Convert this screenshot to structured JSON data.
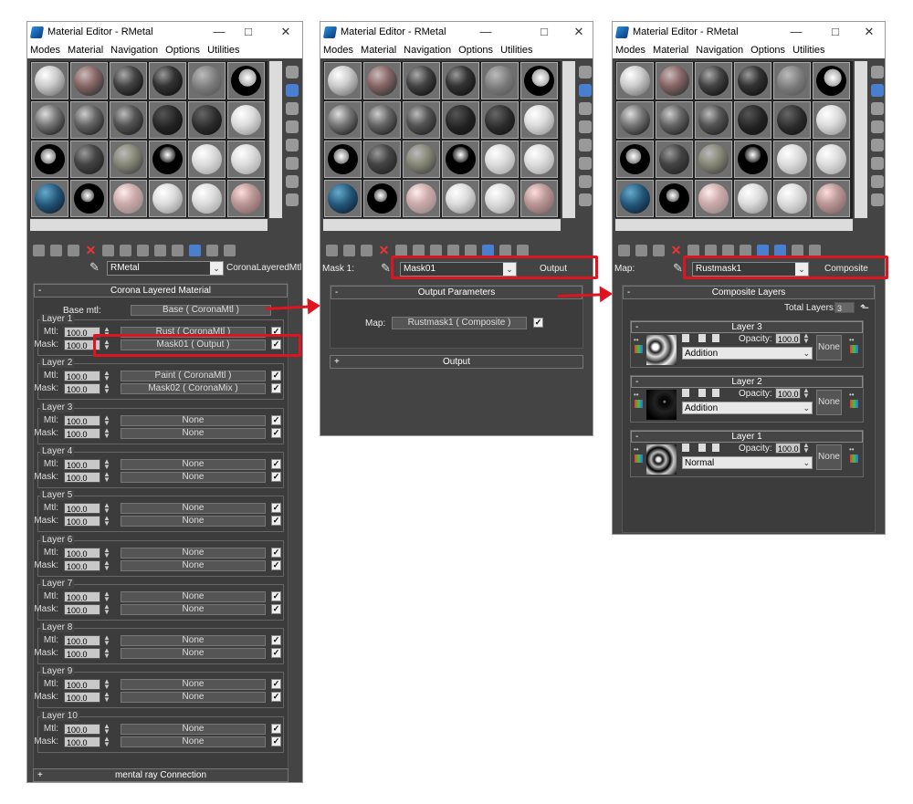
{
  "window_title": "Material Editor - RMetal",
  "window_controls": {
    "minimize": "—",
    "maximize": "□",
    "close": "✕"
  },
  "menu": [
    "Modes",
    "Material",
    "Navigation",
    "Options",
    "Utilities"
  ],
  "pick_icon": "eyedropper-icon",
  "win1": {
    "material_name": "RMetal",
    "material_type": "CoronaLayeredMtl",
    "rollout_title": "Corona Layered Material",
    "base_label": "Base mtl:",
    "base_value": "Base  ( CoronaMtl )",
    "mtl_label": "Mtl:",
    "mask_label": "Mask:",
    "layers": [
      {
        "title": "Layer 1",
        "mtl_amt": "100.0",
        "mask_amt": "100.0",
        "mtl": "Rust  ( CoronaMtl )",
        "mask": "Mask01  ( Output )"
      },
      {
        "title": "Layer 2",
        "mtl_amt": "100.0",
        "mask_amt": "100.0",
        "mtl": "Paint  ( CoronaMtl )",
        "mask": "Mask02  ( CoronaMix )"
      },
      {
        "title": "Layer 3",
        "mtl_amt": "100.0",
        "mask_amt": "100.0",
        "mtl": "None",
        "mask": "None"
      },
      {
        "title": "Layer 4",
        "mtl_amt": "100.0",
        "mask_amt": "100.0",
        "mtl": "None",
        "mask": "None"
      },
      {
        "title": "Layer 5",
        "mtl_amt": "100.0",
        "mask_amt": "100.0",
        "mtl": "None",
        "mask": "None"
      },
      {
        "title": "Layer 6",
        "mtl_amt": "100.0",
        "mask_amt": "100.0",
        "mtl": "None",
        "mask": "None"
      },
      {
        "title": "Layer 7",
        "mtl_amt": "100.0",
        "mask_amt": "100.0",
        "mtl": "None",
        "mask": "None"
      },
      {
        "title": "Layer 8",
        "mtl_amt": "100.0",
        "mask_amt": "100.0",
        "mtl": "None",
        "mask": "None"
      },
      {
        "title": "Layer 9",
        "mtl_amt": "100.0",
        "mask_amt": "100.0",
        "mtl": "None",
        "mask": "None"
      },
      {
        "title": "Layer 10",
        "mtl_amt": "100.0",
        "mask_amt": "100.0",
        "mtl": "None",
        "mask": "None"
      }
    ],
    "mental_ray": "mental ray Connection"
  },
  "win2": {
    "slot_label": "Mask 1:",
    "map_name": "Mask01",
    "map_type": "Output",
    "rollout_title": "Output Parameters",
    "map_label": "Map:",
    "map_value": "Rustmask1  ( Composite )",
    "output_rollout": "Output"
  },
  "win3": {
    "slot_label": "Map:",
    "map_name": "Rustmask1",
    "map_type": "Composite",
    "rollout_title": "Composite Layers",
    "total_layers_label": "Total Layers:",
    "total_layers_value": "3",
    "opacity_label": "Opacity:",
    "layers": [
      {
        "title": "Layer 3",
        "opacity": "100.0",
        "blend": "Addition",
        "mask": "None"
      },
      {
        "title": "Layer 2",
        "opacity": "100.0",
        "blend": "Addition",
        "mask": "None"
      },
      {
        "title": "Layer 1",
        "opacity": "100.0",
        "blend": "Normal",
        "mask": "None"
      }
    ]
  },
  "colors": {
    "highlight": "#e0141e",
    "panel": "#444444",
    "accent_blue": "#4a7fd0"
  }
}
